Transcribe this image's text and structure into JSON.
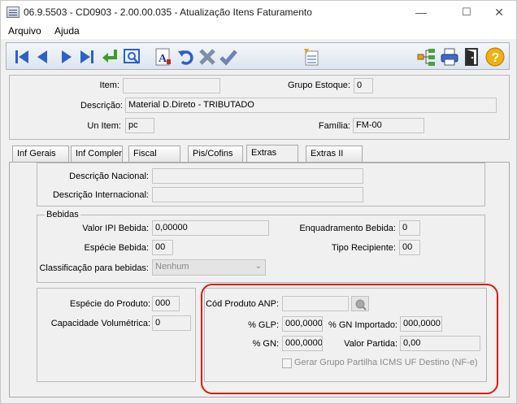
{
  "window": {
    "title": "06.9.5503 - CD0903 - 2.00.00.035 - Atualização Itens Faturamento",
    "minimize": "—",
    "maximize": "☐",
    "close": "✕"
  },
  "menu": {
    "items": [
      "Arquivo",
      "Ajuda"
    ]
  },
  "toolbar": {
    "icons": [
      "first-icon",
      "previous-icon",
      "next-icon",
      "last-icon",
      "goto-icon",
      "search-icon",
      "font-icon",
      "undo-icon",
      "delete-icon",
      "confirm-icon",
      "spreadsheet-icon",
      "hierarchy-icon",
      "print-icon",
      "exit-icon",
      "help-icon"
    ]
  },
  "header": {
    "item_label": "Item:",
    "item_value": "",
    "grupo_estoque_label": "Grupo Estoque:",
    "grupo_estoque_value": "0",
    "descricao_label": "Descrição:",
    "descricao_value": "Material D.Direto - TRIBUTADO",
    "un_item_label": "Un Item:",
    "un_item_value": "pc",
    "familia_label": "Família:",
    "familia_value": "FM-00"
  },
  "tabs": [
    {
      "label": "Inf Gerais"
    },
    {
      "label": "Inf Complem"
    },
    {
      "label": "Fiscal"
    },
    {
      "label": "Pis/Cofins"
    },
    {
      "label": "Extras"
    },
    {
      "label": "Extras II"
    }
  ],
  "extras": {
    "descricao_nacional_label": "Descrição Nacional:",
    "descricao_nacional_value": "",
    "descricao_internacional_label": "Descrição Internacional:",
    "descricao_internacional_value": "",
    "bebidas": {
      "title": "Bebidas",
      "valor_ipi_label": "Valor IPI Bebida:",
      "valor_ipi_value": "0,00000",
      "enquadramento_label": "Enquadramento Bebida:",
      "enquadramento_value": "0",
      "especie_label": "Espécie Bebida:",
      "especie_value": "00",
      "tipo_recipiente_label": "Tipo Recipiente:",
      "tipo_recipiente_value": "00",
      "classificacao_label": "Classificação para bebidas:",
      "classificacao_value": "Nenhum"
    },
    "produto": {
      "especie_label": "Espécie do Produto:",
      "especie_value": "000",
      "capacidade_label": "Capacidade Volumétrica:",
      "capacidade_value": "0"
    },
    "anp": {
      "cod_label": "Cód Produto ANP:",
      "cod_value": "",
      "glp_label": "% GLP:",
      "glp_value": "000,0000",
      "gn_importado_label": "% GN Importado:",
      "gn_importado_value": "000,0000",
      "gn_label": "% GN:",
      "gn_value": "000,0000",
      "valor_partida_label": "Valor Partida:",
      "valor_partida_value": "0,00",
      "gerar_grupo_label": "Gerar Grupo Partilha ICMS UF Destino (NF-e)"
    }
  },
  "colors": {
    "highlight": "#e01818",
    "toolbar_blue": "#2a62c8",
    "window_bg": "#f0f0f0"
  }
}
